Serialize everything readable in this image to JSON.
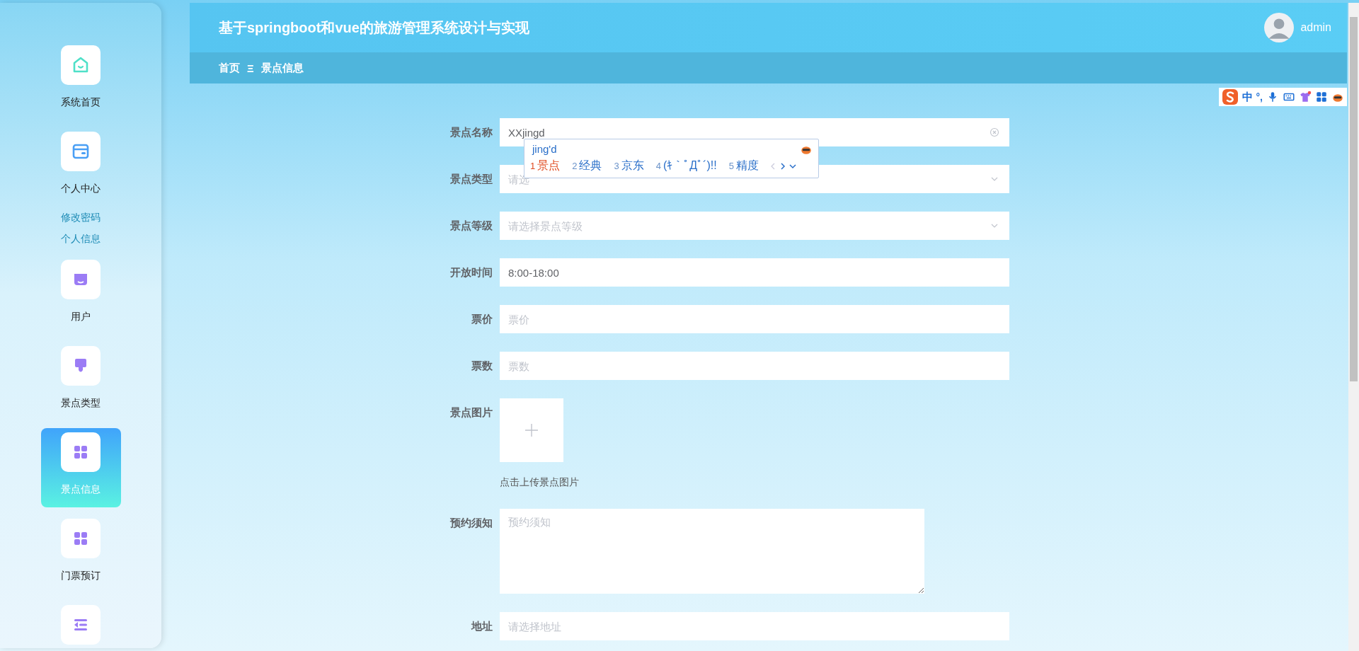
{
  "sidebar": {
    "items": [
      {
        "kind": "home",
        "label": "系统首页",
        "selected": false
      },
      {
        "kind": "card",
        "label": "个人中心",
        "selected": false,
        "children": [
          {
            "label": "修改密码"
          },
          {
            "label": "个人信息"
          }
        ]
      },
      {
        "kind": "shop",
        "label": "用户",
        "selected": false
      },
      {
        "kind": "brush",
        "label": "景点类型",
        "selected": false
      },
      {
        "kind": "grid",
        "label": "景点信息",
        "selected": true
      },
      {
        "kind": "grid",
        "label": "门票预订",
        "selected": false
      },
      {
        "kind": "list",
        "selected": false
      }
    ]
  },
  "header": {
    "title": "基于springboot和vue的旅游管理系统设计与实现",
    "user": "admin"
  },
  "breadcrumb": {
    "items": [
      "首页",
      "景点信息"
    ],
    "separator": "Ξ"
  },
  "ime_toolbar": {
    "mode": "中",
    "punctuation": "°,"
  },
  "form": {
    "fields": [
      {
        "kind": "text",
        "label": "景点名称",
        "value": "XXjingd",
        "clearable": true
      },
      {
        "kind": "select",
        "label": "景点类型",
        "placeholder": "请选"
      },
      {
        "kind": "select",
        "label": "景点等级",
        "placeholder": "请选择景点等级"
      },
      {
        "kind": "text",
        "label": "开放时间",
        "value": "8:00-18:00"
      },
      {
        "kind": "text",
        "label": "票价",
        "placeholder": "票价"
      },
      {
        "kind": "text",
        "label": "票数",
        "placeholder": "票数"
      },
      {
        "kind": "upload",
        "label": "景点图片",
        "hint": "点击上传景点图片"
      },
      {
        "kind": "textarea",
        "label": "预约须知",
        "placeholder": "预约须知"
      },
      {
        "kind": "text",
        "label": "地址",
        "placeholder": "请选择地址"
      }
    ]
  },
  "ime": {
    "composition": "jing'd",
    "candidates": [
      {
        "index": "1",
        "text": "景点",
        "selected": true
      },
      {
        "index": "2",
        "text": "经典",
        "selected": false
      },
      {
        "index": "3",
        "text": "京东",
        "selected": false
      },
      {
        "index": "4",
        "text": "(ｷ｀ﾟДﾟ´)!!",
        "selected": false
      },
      {
        "index": "5",
        "text": "精度",
        "selected": false
      }
    ]
  }
}
